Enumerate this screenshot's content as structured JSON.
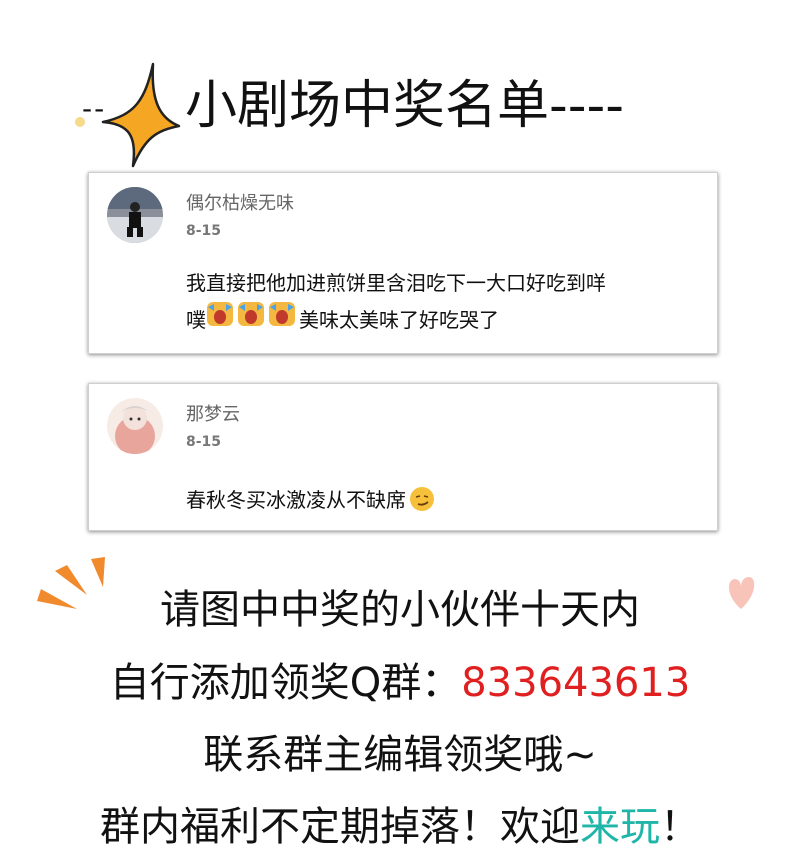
{
  "title": {
    "dashes": "--",
    "text": "小剧场中奖名单----"
  },
  "comments": [
    {
      "username": "偶尔枯燥无味",
      "date": "8-15",
      "line1": "我直接把他加进煎饼里含泪吃下一大口好吃到咩",
      "line2_prefix": "噗",
      "line2_suffix": "美味太美味了好吃哭了"
    },
    {
      "username": "那梦云",
      "date": "8-15",
      "line1": "春秋冬买冰激凌从不缺席"
    }
  ],
  "notice": {
    "line1": "请图中中奖的小伙伴十天内",
    "line2_prefix": "自行添加领奖Q群：",
    "line2_number": "833643613",
    "line3": "联系群主编辑领奖哦~",
    "line4_prefix": "群内福利不定期掉落！欢迎",
    "line4_highlight": "来玩",
    "line4_suffix": "！"
  },
  "colors": {
    "accent_red": "#e02020",
    "accent_teal": "#1fb6a8",
    "sparkle_orange": "#f5a623"
  }
}
